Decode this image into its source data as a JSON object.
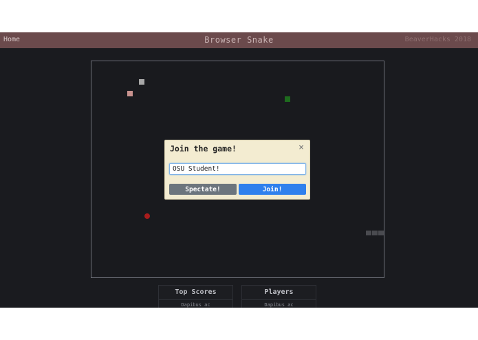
{
  "navbar": {
    "home_label": "Home",
    "title": "Browser Snake",
    "right_label": "BeaverHacks 2018"
  },
  "modal": {
    "title": "Join the game!",
    "close_symbol": "×",
    "name_input_value": "OSU Student!",
    "spectate_label": "Spectate!",
    "join_label": "Join!"
  },
  "panels": {
    "top_scores": {
      "title": "Top Scores",
      "row": "Dapibus ac"
    },
    "players": {
      "title": "Players",
      "row": "Dapibus ac"
    }
  },
  "colors": {
    "navbar_bg": "#6b4a4c",
    "board_bg": "#191a1e",
    "modal_bg": "#f3ecd1",
    "spectate_button": "#6c757d",
    "join_button": "#2f80ed",
    "food": "#a81c1c",
    "snake_green": "#1e6b1e",
    "snake_pink": "#c8928e",
    "snake_gray": "#a8a8a8"
  }
}
